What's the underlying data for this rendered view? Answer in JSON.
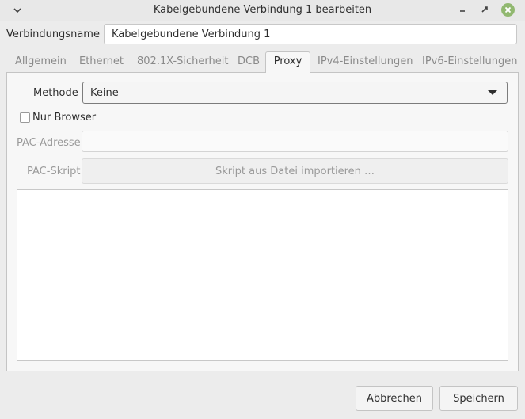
{
  "window": {
    "title": "Kabelgebundene Verbindung 1 bearbeiten",
    "icons": [
      "chevron-down-icon",
      "minimize-icon",
      "restore-icon",
      "close-icon"
    ],
    "close_color": "#91b870"
  },
  "connection_name": {
    "label": "Verbindungsname",
    "value": "Kabelgebundene Verbindung 1"
  },
  "tabs": [
    {
      "label": "Allgemein",
      "active": false
    },
    {
      "label": "Ethernet",
      "active": false
    },
    {
      "label": "802.1X-Sicherheit",
      "active": false
    },
    {
      "label": "DCB",
      "active": false
    },
    {
      "label": "Proxy",
      "active": true
    },
    {
      "label": "IPv4-Einstellungen",
      "active": false
    },
    {
      "label": "IPv6-Einstellungen",
      "active": false
    }
  ],
  "proxy": {
    "method_label": "Methode",
    "method_value": "Keine",
    "browser_only_label": "Nur Browser",
    "browser_only_checked": false,
    "pac_address_label": "PAC-Adresse",
    "pac_address_value": "",
    "pac_script_label": "PAC-Skript",
    "import_script_label": "Skript aus Datei importieren …",
    "script_text": ""
  },
  "footer": {
    "cancel_label": "Abbrechen",
    "save_label": "Speichern"
  }
}
